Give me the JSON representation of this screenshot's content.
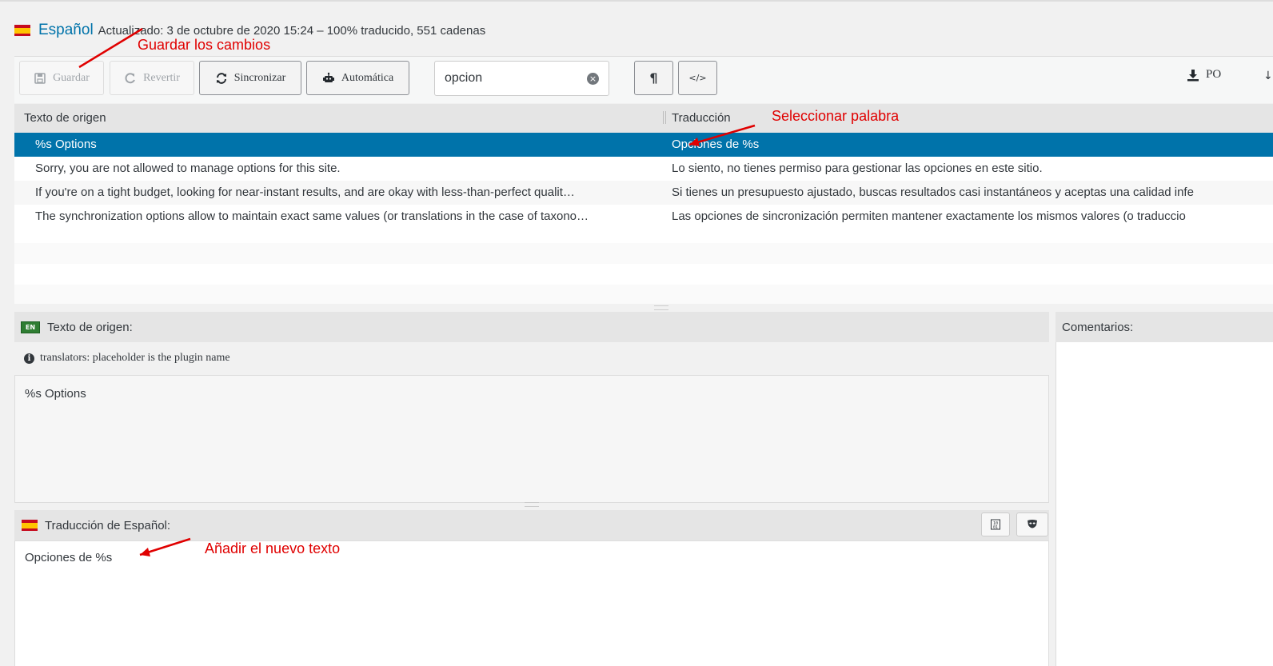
{
  "header": {
    "language": "Español",
    "meta": "Actualizado: 3 de octubre de 2020 15:24 – 100% traducido, 551 cadenas"
  },
  "toolbar": {
    "save_label": "Guardar",
    "revert_label": "Revertir",
    "sync_label": "Sincronizar",
    "auto_label": "Automática",
    "search_value": "opcion",
    "pilcrow_label": "¶",
    "code_label": "</>",
    "po_label": "PO"
  },
  "grid": {
    "col_source": "Texto de origen",
    "col_translation": "Traducción",
    "rows": [
      {
        "source": "%s Options",
        "translation": "Opciones de %s"
      },
      {
        "source": "Sorry, you are not allowed to manage options for this site.",
        "translation": "Lo siento, no tienes permiso para gestionar las opciones en este sitio."
      },
      {
        "source": "If you're on a tight budget, looking for near-instant results, and are okay with less-than-perfect qualit…",
        "translation": "Si tienes un presupuesto ajustado, buscas resultados casi instantáneos y aceptas una calidad infe"
      },
      {
        "source": "The synchronization options allow to maintain exact same values (or translations in the case of taxono…",
        "translation": "Las opciones de sincronización permiten mantener exactamente los mismos valores (o traduccio"
      }
    ]
  },
  "source_panel": {
    "badge": "EN",
    "title": "Texto de origen:",
    "note": "translators: placeholder is the plugin name",
    "text": "%s Options"
  },
  "translation_panel": {
    "title": "Traducción de Español:",
    "text": "Opciones de %s"
  },
  "comments_panel": {
    "title": "Comentarios:"
  },
  "annotations": {
    "save": "Guardar los cambios",
    "select": "Seleccionar palabra",
    "add": "Añadir el nuevo texto"
  },
  "colors": {
    "accent": "#0073aa",
    "annotation": "#e00000"
  }
}
